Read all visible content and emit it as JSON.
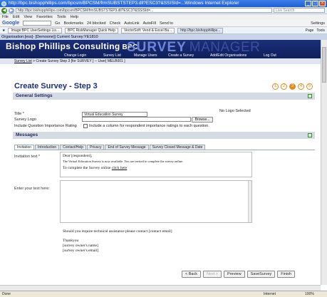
{
  "window": {
    "title": "http://bpc.bishopphillips.com/bpcsm/BPCSM/frmSUBSTSTEP3.dll?ESC3?&SSISId=...Windows Internet Explorer",
    "url": "http://bpc.bishopphillips.com/bpcsm/BPCSM/frmSUBSTSTEP3.dll?ESC3?&SSISId=...",
    "search_placeholder": "Live Search"
  },
  "menu": [
    "File",
    "Edit",
    "View",
    "Favorites",
    "Tools",
    "Help"
  ],
  "google_bar": {
    "logo": "Google",
    "items": [
      "Go",
      "Bookmarks",
      "24 blocked",
      "Check",
      "AutoLink",
      "AutoFill",
      "Send to"
    ],
    "settings": "Settings"
  },
  "favorites": {
    "tabs": [
      "Image:BPC UserSettings Lis...",
      "BPC RiskManager Quick Help",
      "VectorSoft: Vend & Excel Ba...",
      "http://bpc.bishopphillips..."
    ],
    "right": [
      "Page",
      "Tools"
    ]
  },
  "org_bar": "Organisation:[ess]- [Demoone]| Current Survey:YE1810",
  "banner": {
    "company": "Bishop Phillips Consulting",
    "company_abbr": "BPC",
    "product": "SURVEY",
    "product_suffix": "MANAGER",
    "nav": [
      "Change Login",
      "Survey List",
      "Manage Users",
      "Create a Survey",
      "Add/Edit Organisations",
      "Log Out"
    ]
  },
  "breadcrumb": {
    "link": "Survey List",
    "rest": " > Create Survey Step 3 [for SURVEY ] -- User[ MELB001 ]"
  },
  "page": {
    "title": "Create Survey - Step 3",
    "steps": [
      "1",
      "2",
      "3",
      "4",
      "5"
    ],
    "current_step": 3
  },
  "general": {
    "header": "General Settings",
    "title_label": "Title *",
    "title_value": "Virtual Education Survey",
    "logo_label": "Survey Logo",
    "browse_label": "Browse...",
    "no_logo": "No Logo Selected",
    "rating_label": "Include Question Importance Rating",
    "rating_checkbox_label": "Include a column for respondent importance ratings to each question."
  },
  "messages": {
    "header": "Messages",
    "tabs": [
      "Invitation",
      "Introduction",
      "Contact/Help",
      "Privacy",
      "End of Survey Message",
      "Survey Closed Message & Date"
    ],
    "active_tab": 0,
    "invitation_label": "Invitation text *",
    "your_text_label": "Enter your text here:",
    "rte_line1": "Dear [respondent],",
    "rte_line2": "The Virtual Education Survey is now available. You are invited to complete the survey online.",
    "rte_line3": "To complete the Survey online ",
    "rte_link": "click here",
    "closing_line1": "Should you require technical assistance please contact [contact email]",
    "closing_line2": "Thankyou",
    "closing_line3": "[survey owner's name]",
    "closing_line4": "[survey owner's email]"
  },
  "buttons": {
    "back": "< Back",
    "next": "Next >",
    "preview": "Preview",
    "save": "SaveSurvey",
    "finish": "Finish"
  },
  "status": {
    "left": "Done",
    "zone": "Internet",
    "zoom": "100%"
  },
  "colors": {
    "banner_bg": "#1b2f7a",
    "accent_orange": "#e28a1a",
    "title_blue": "#1f2f78"
  }
}
